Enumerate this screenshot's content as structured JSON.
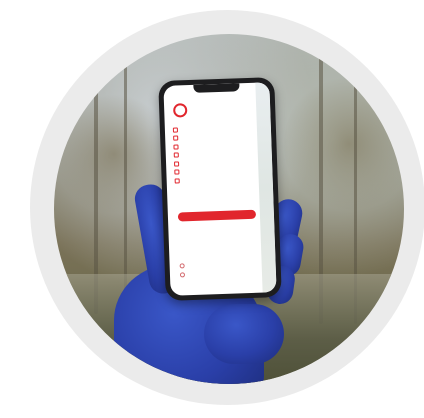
{
  "app": {
    "brand_name": "",
    "menu": [
      {
        "icon": "profile-icon",
        "label": ""
      },
      {
        "icon": "calendar-icon",
        "label": ""
      },
      {
        "icon": "document-icon",
        "label": ""
      },
      {
        "icon": "notification-icon",
        "label": ""
      },
      {
        "icon": "chat-icon",
        "label": ""
      },
      {
        "icon": "building-icon",
        "label": ""
      },
      {
        "icon": "location-icon",
        "label": ""
      }
    ],
    "cta_label": "",
    "footer": [
      {
        "icon": "settings-icon",
        "label": ""
      },
      {
        "icon": "help-icon",
        "label": ""
      }
    ]
  },
  "colors": {
    "accent": "#e1262d",
    "glove": "#2a3fa8",
    "ring": "#ebebeb"
  }
}
